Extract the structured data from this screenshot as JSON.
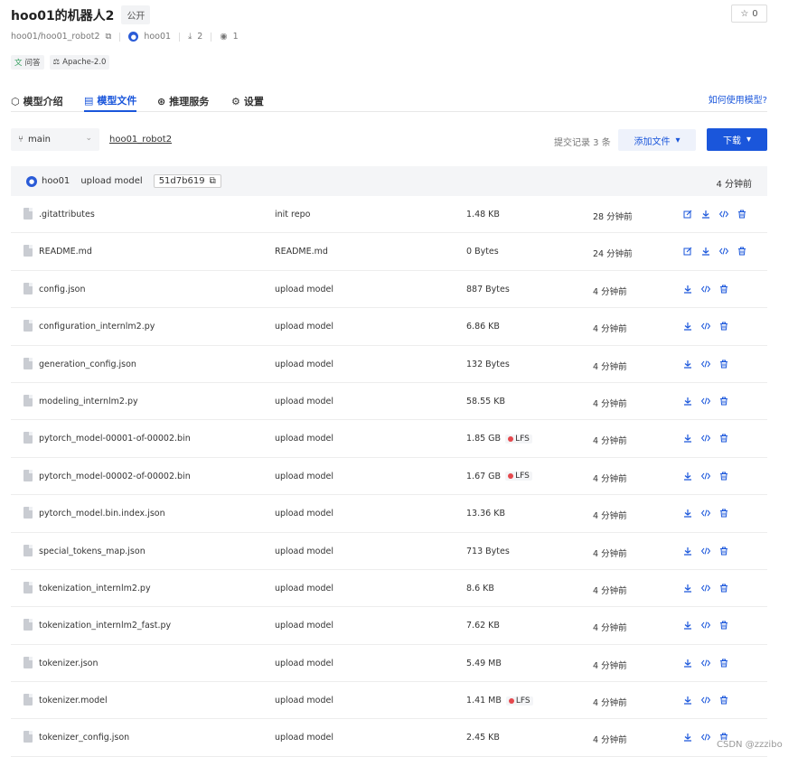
{
  "repo": {
    "title": "hoo01的机器人2",
    "visibility": "公开",
    "stars": "0",
    "path": "hoo01/hoo01_robot2",
    "owner": "hoo01",
    "downloads": "2",
    "views": "1"
  },
  "tags": [
    {
      "icon": "translate-icon",
      "label": "问答"
    },
    {
      "icon": "license-icon",
      "label": "Apache-2.0"
    }
  ],
  "tabs": [
    {
      "icon": "cube-icon",
      "label": "模型介绍"
    },
    {
      "icon": "file-icon",
      "label": "模型文件"
    },
    {
      "icon": "inference-icon",
      "label": "推理服务"
    },
    {
      "icon": "gear-icon",
      "label": "设置"
    }
  ],
  "howto_link": "如何使用模型?",
  "toolbar": {
    "branch": "main",
    "repo_path": "hoo01_robot2",
    "commit_count": "提交记录 3 条",
    "add_file": "添加文件",
    "download": "下载"
  },
  "commit": {
    "author": "hoo01",
    "message": "upload model",
    "hash": "51d7b619",
    "time": "4 分钟前"
  },
  "files": [
    {
      "name": ".gitattributes",
      "message": "init repo",
      "size": "1.48 KB",
      "lfs": "",
      "time": "28 分钟前"
    },
    {
      "name": "README.md",
      "message": "README.md",
      "size": "0 Bytes",
      "lfs": "",
      "time": "24 分钟前"
    },
    {
      "name": "config.json",
      "message": "upload model",
      "size": "887 Bytes",
      "lfs": "",
      "time": "4 分钟前"
    },
    {
      "name": "configuration_internlm2.py",
      "message": "upload model",
      "size": "6.86 KB",
      "lfs": "",
      "time": "4 分钟前"
    },
    {
      "name": "generation_config.json",
      "message": "upload model",
      "size": "132 Bytes",
      "lfs": "",
      "time": "4 分钟前"
    },
    {
      "name": "modeling_internlm2.py",
      "message": "upload model",
      "size": "58.55 KB",
      "lfs": "",
      "time": "4 分钟前"
    },
    {
      "name": "pytorch_model-00001-of-00002.bin",
      "message": "upload model",
      "size": "1.85 GB",
      "lfs": "LFS",
      "time": "4 分钟前"
    },
    {
      "name": "pytorch_model-00002-of-00002.bin",
      "message": "upload model",
      "size": "1.67 GB",
      "lfs": "LFS",
      "time": "4 分钟前"
    },
    {
      "name": "pytorch_model.bin.index.json",
      "message": "upload model",
      "size": "13.36 KB",
      "lfs": "",
      "time": "4 分钟前"
    },
    {
      "name": "special_tokens_map.json",
      "message": "upload model",
      "size": "713 Bytes",
      "lfs": "",
      "time": "4 分钟前"
    },
    {
      "name": "tokenization_internlm2.py",
      "message": "upload model",
      "size": "8.6 KB",
      "lfs": "",
      "time": "4 分钟前"
    },
    {
      "name": "tokenization_internlm2_fast.py",
      "message": "upload model",
      "size": "7.62 KB",
      "lfs": "",
      "time": "4 分钟前"
    },
    {
      "name": "tokenizer.json",
      "message": "upload model",
      "size": "5.49 MB",
      "lfs": "",
      "time": "4 分钟前"
    },
    {
      "name": "tokenizer.model",
      "message": "upload model",
      "size": "1.41 MB",
      "lfs": "LFS",
      "time": "4 分钟前"
    },
    {
      "name": "tokenizer_config.json",
      "message": "upload model",
      "size": "2.45 KB",
      "lfs": "",
      "time": "4 分钟前"
    }
  ],
  "editable_rows": [
    0,
    1
  ],
  "watermark": "CSDN @zzzibo",
  "colors": {
    "accent": "#1a56db",
    "lfs_dot": "#e5484d"
  }
}
